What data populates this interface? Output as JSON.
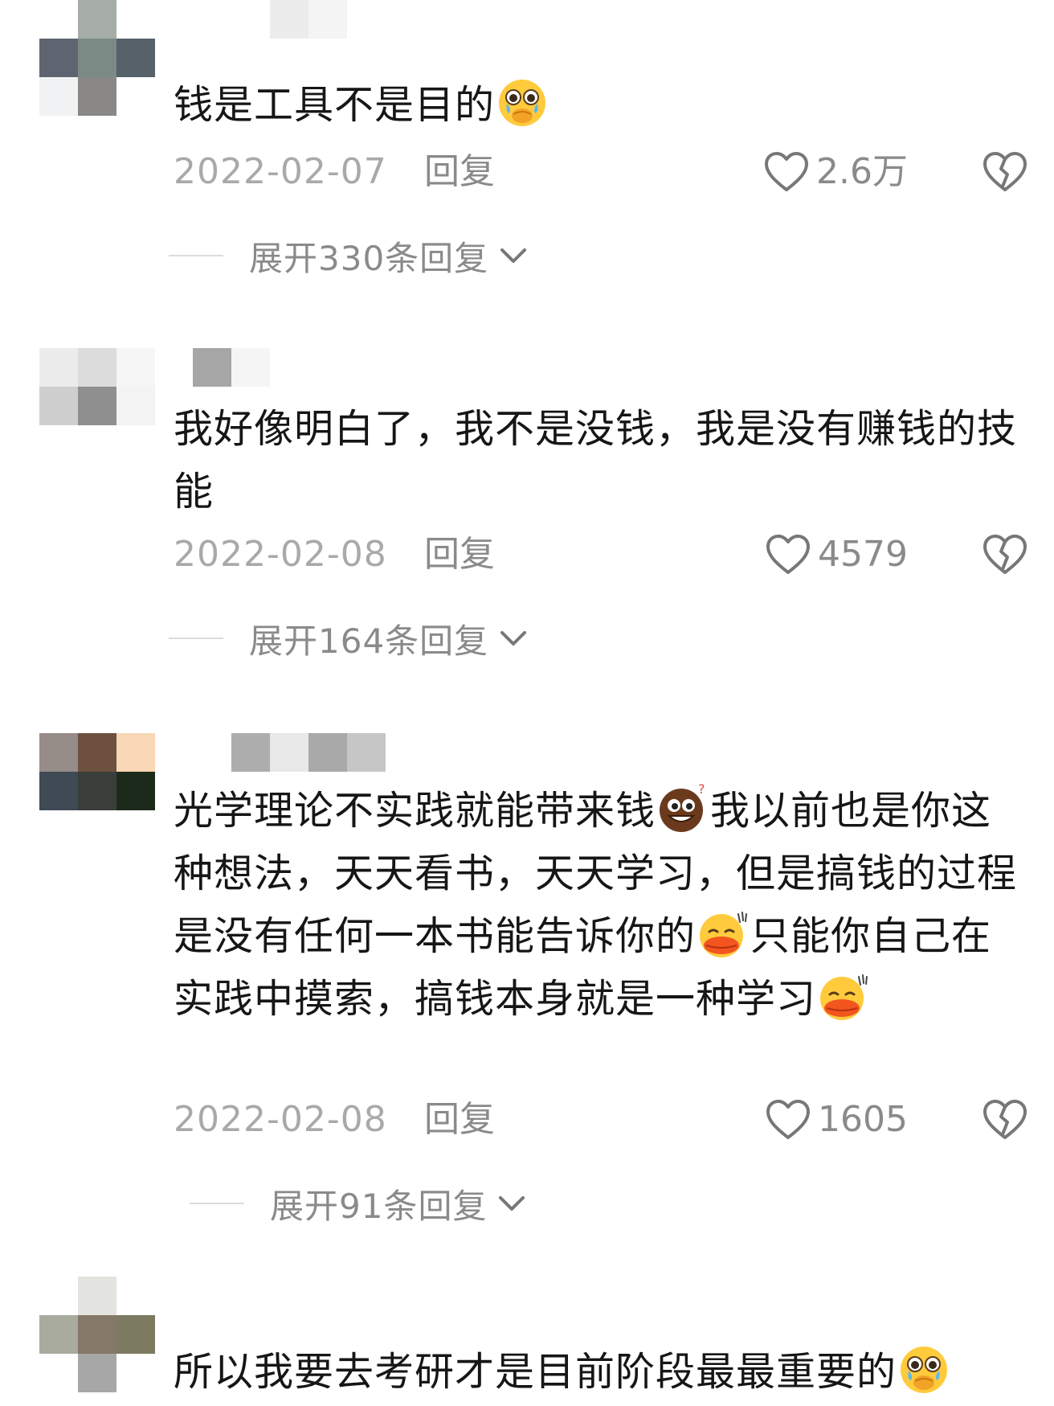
{
  "comments": [
    {
      "text_parts": [
        "钱是工具不是目的",
        ""
      ],
      "emojis": [
        "pleading-cry-emoji"
      ],
      "date": "2022-02-07",
      "reply_label": "回复",
      "likes": "2.6万",
      "expand_label": "展开330条回复"
    },
    {
      "text_parts": [
        "我好像明白了，我不是没钱，我是没有赚钱的技能"
      ],
      "date": "2022-02-08",
      "reply_label": "回复",
      "likes": "4579",
      "expand_label": "展开164条回复"
    },
    {
      "text_parts": [
        "光学理论不实践就能带来钱",
        "我以前也是你这种想法，天天看书，天天学习，但是搞钱的过程是没有任何一本书能告诉你的",
        "只能你自己在实践中摸索，搞钱本身就是一种学习",
        ""
      ],
      "emojis": [
        "brown-grin-emoji",
        "kiss-lips-emoji",
        "kiss-lips-emoji"
      ],
      "date": "2022-02-08",
      "reply_label": "回复",
      "likes": "1605",
      "expand_label": "展开91条回复"
    },
    {
      "text_parts": [
        "所以我要去考研才是目前阶段最最重要的",
        ""
      ],
      "emojis": [
        "pleading-cry-emoji"
      ]
    }
  ],
  "colors": {
    "text": "#161616",
    "meta_gray": "#a9a9a9",
    "action_gray": "#8a8a8a",
    "divider": "#dcdcdc"
  }
}
